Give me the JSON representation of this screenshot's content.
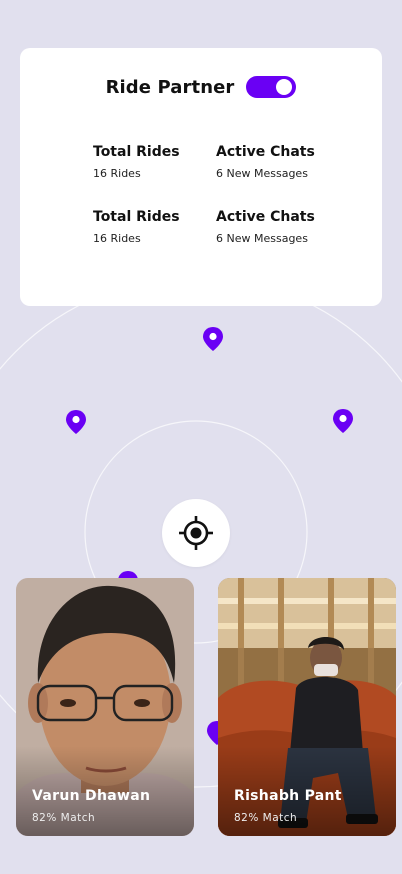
{
  "header": {
    "title": "Ride Partner",
    "toggle_on": true
  },
  "stats": [
    {
      "label": "Total Rides",
      "value": "16 Rides"
    },
    {
      "label": "Active Chats",
      "value": "6 New Messages"
    },
    {
      "label": "Total Rides",
      "value": "16 Rides"
    },
    {
      "label": "Active Chats",
      "value": "6 New Messages"
    }
  ],
  "partners": [
    {
      "name": "Varun Dhawan",
      "match": "82% Match"
    },
    {
      "name": "Rishabh Pant",
      "match": "82% Match"
    }
  ],
  "colors": {
    "background": "#e1e0ee",
    "accent": "#6a00f4",
    "card": "#ffffff"
  },
  "icons": {
    "pin": "location-pin-icon",
    "locate": "crosshair-icon"
  }
}
